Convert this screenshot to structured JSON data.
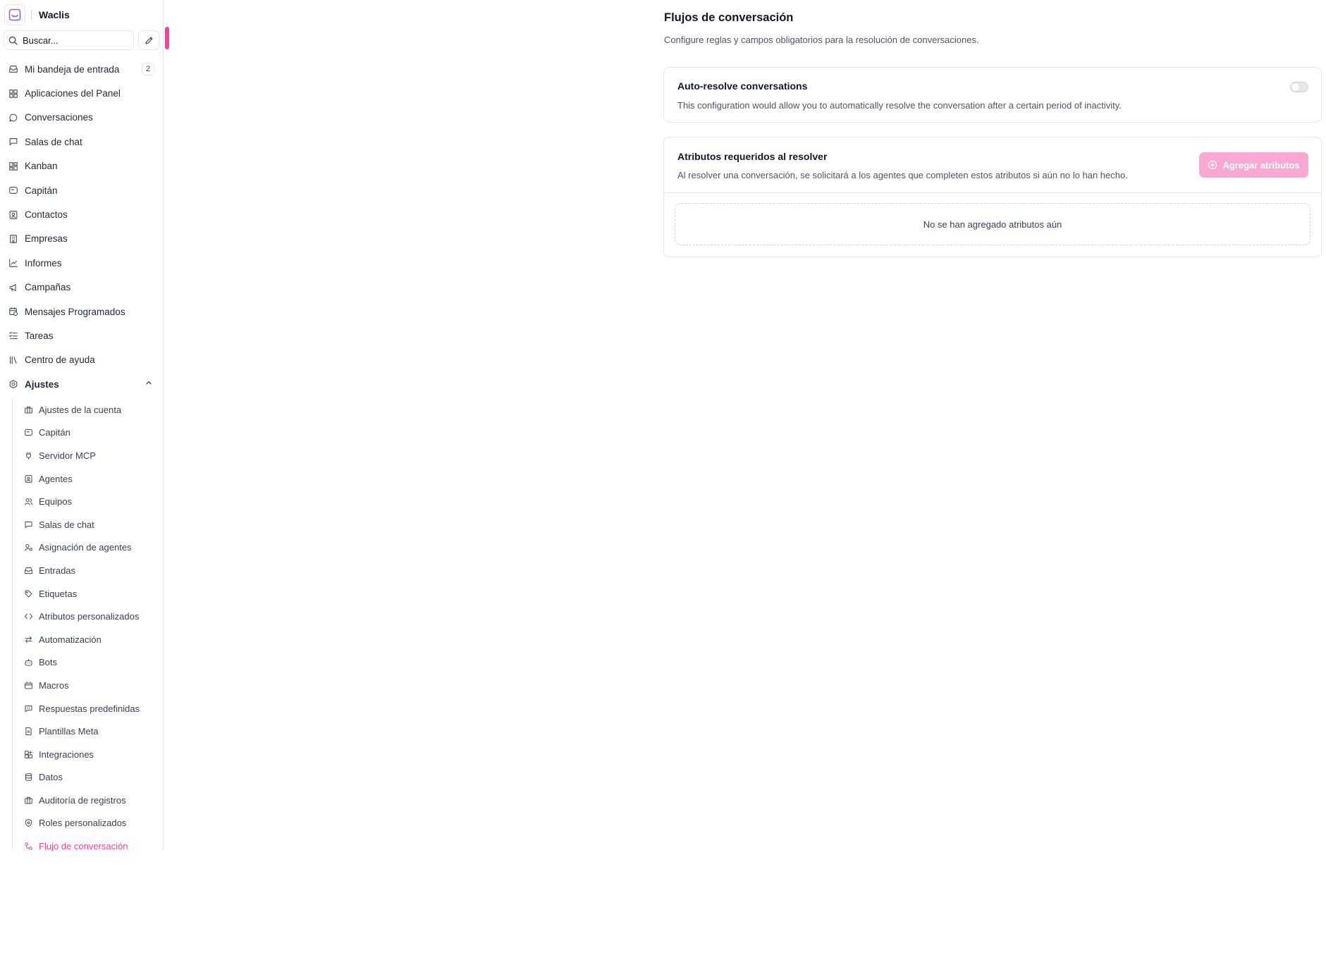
{
  "brand": {
    "name": "Waclis"
  },
  "search": {
    "placeholder": "Buscar..."
  },
  "nav": {
    "items": [
      {
        "label": "Mi bandeja de entrada",
        "icon": "inbox-icon",
        "badge": "2"
      },
      {
        "label": "Aplicaciones del Panel",
        "icon": "grid-icon"
      },
      {
        "label": "Conversaciones",
        "icon": "chat-bubble-icon"
      },
      {
        "label": "Salas de chat",
        "icon": "message-square-icon"
      },
      {
        "label": "Kanban",
        "icon": "kanban-icon"
      },
      {
        "label": "Capitán",
        "icon": "captain-icon"
      },
      {
        "label": "Contactos",
        "icon": "contact-icon"
      },
      {
        "label": "Empresas",
        "icon": "building-icon"
      },
      {
        "label": "Informes",
        "icon": "chart-line-icon"
      },
      {
        "label": "Campañas",
        "icon": "megaphone-icon"
      },
      {
        "label": "Mensajes Programados",
        "icon": "calendar-clock-icon"
      },
      {
        "label": "Tareas",
        "icon": "checklist-icon"
      },
      {
        "label": "Centro de ayuda",
        "icon": "library-icon"
      },
      {
        "label": "Ajustes",
        "icon": "settings-icon"
      }
    ]
  },
  "settings": {
    "items": [
      {
        "label": "Ajustes de la cuenta",
        "icon": "briefcase-icon"
      },
      {
        "label": "Capitán",
        "icon": "captain-icon"
      },
      {
        "label": "Servidor MCP",
        "icon": "plug-icon"
      },
      {
        "label": "Agentes",
        "icon": "contact-icon"
      },
      {
        "label": "Equipos",
        "icon": "users-icon"
      },
      {
        "label": "Salas de chat",
        "icon": "message-square-icon"
      },
      {
        "label": "Asignación de agentes",
        "icon": "user-cog-icon"
      },
      {
        "label": "Entradas",
        "icon": "inbox-icon"
      },
      {
        "label": "Etiquetas",
        "icon": "tags-icon"
      },
      {
        "label": "Atributos personalizados",
        "icon": "code-icon"
      },
      {
        "label": "Automatización",
        "icon": "arrows-icon"
      },
      {
        "label": "Bots",
        "icon": "bot-icon"
      },
      {
        "label": "Macros",
        "icon": "macro-icon"
      },
      {
        "label": "Respuestas predefinidas",
        "icon": "canned-response-icon"
      },
      {
        "label": "Plantillas Meta",
        "icon": "file-text-icon"
      },
      {
        "label": "Integraciones",
        "icon": "integrations-icon"
      },
      {
        "label": "Datos",
        "icon": "database-icon"
      },
      {
        "label": "Auditoría de registros",
        "icon": "briefcase-icon"
      },
      {
        "label": "Roles personalizados",
        "icon": "shield-icon"
      },
      {
        "label": "Flujo de conversación",
        "icon": "workflow-icon"
      }
    ]
  },
  "main": {
    "title": "Flujos de conversación",
    "description": "Configure reglas y campos obligatorios para la resolución de conversaciones.",
    "auto_resolve": {
      "title": "Auto-resolve conversations",
      "description": "This configuration would allow you to automatically resolve the conversation after a certain period of inactivity.",
      "enabled": false
    },
    "required_attributes": {
      "title": "Atributos requeridos al resolver",
      "description": "Al resolver una conversación, se solicitará a los agentes que completen estos atributos si aún no lo han hecho.",
      "add_button": "Agregar atributos",
      "empty_text": "No se han agregado atributos aún"
    }
  },
  "colors": {
    "accent": "#ec4899",
    "button_disabled": "#f9a8d4",
    "border": "#e5e7eb"
  }
}
